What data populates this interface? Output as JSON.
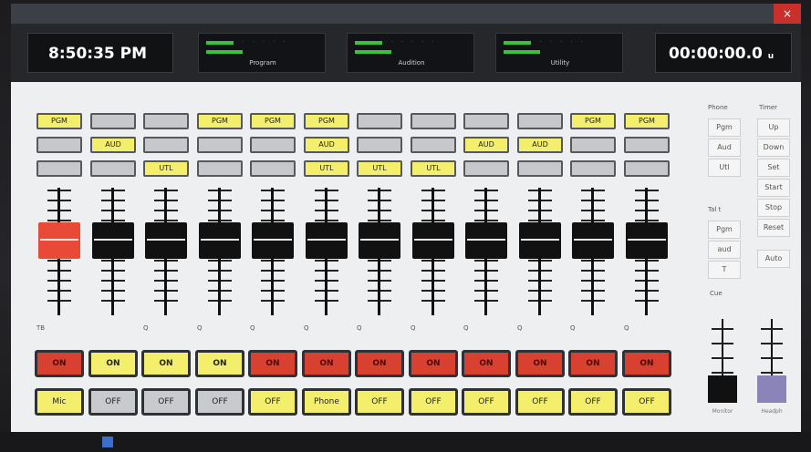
{
  "window": {
    "title": ""
  },
  "clock": {
    "time": "8:50:35 PM",
    "timer": "00:00:00.0",
    "timer_suffix": "u"
  },
  "meters": [
    {
      "label": "Program"
    },
    {
      "label": "Audition"
    },
    {
      "label": "Utility"
    }
  ],
  "channels": [
    {
      "pgm": "PGM",
      "aud": "",
      "utl": "",
      "name": "TB",
      "on": "ON",
      "on_color": "red",
      "off": "Mic",
      "off_color": "yellow",
      "knob": "red"
    },
    {
      "pgm": "",
      "aud": "AUD",
      "utl": "",
      "name": "",
      "on": "ON",
      "on_color": "yellow",
      "off": "OFF",
      "off_color": "gray",
      "knob": "black"
    },
    {
      "pgm": "",
      "aud": "",
      "utl": "UTL",
      "name": "Q",
      "on": "ON",
      "on_color": "yellow",
      "off": "OFF",
      "off_color": "gray",
      "knob": "black"
    },
    {
      "pgm": "PGM",
      "aud": "",
      "utl": "",
      "name": "Q",
      "on": "ON",
      "on_color": "yellow",
      "off": "OFF",
      "off_color": "gray",
      "knob": "black"
    },
    {
      "pgm": "PGM",
      "aud": "",
      "utl": "",
      "name": "Q",
      "on": "ON",
      "on_color": "red",
      "off": "OFF",
      "off_color": "yellow",
      "knob": "black"
    },
    {
      "pgm": "PGM",
      "aud": "AUD",
      "utl": "UTL",
      "name": "Q",
      "on": "ON",
      "on_color": "red",
      "off": "Phone",
      "off_color": "yellow",
      "knob": "black"
    },
    {
      "pgm": "",
      "aud": "",
      "utl": "UTL",
      "name": "Q",
      "on": "ON",
      "on_color": "red",
      "off": "OFF",
      "off_color": "yellow",
      "knob": "black"
    },
    {
      "pgm": "",
      "aud": "",
      "utl": "UTL",
      "name": "Q",
      "on": "ON",
      "on_color": "red",
      "off": "OFF",
      "off_color": "yellow",
      "knob": "black"
    },
    {
      "pgm": "",
      "aud": "AUD",
      "utl": "",
      "name": "Q",
      "on": "ON",
      "on_color": "red",
      "off": "OFF",
      "off_color": "yellow",
      "knob": "black"
    },
    {
      "pgm": "",
      "aud": "AUD",
      "utl": "",
      "name": "Q",
      "on": "ON",
      "on_color": "red",
      "off": "OFF",
      "off_color": "yellow",
      "knob": "black"
    },
    {
      "pgm": "PGM",
      "aud": "",
      "utl": "",
      "name": "Q",
      "on": "ON",
      "on_color": "red",
      "off": "OFF",
      "off_color": "yellow",
      "knob": "black"
    },
    {
      "pgm": "PGM",
      "aud": "",
      "utl": "",
      "name": "Q",
      "on": "ON",
      "on_color": "red",
      "off": "OFF",
      "off_color": "yellow",
      "knob": "black"
    }
  ],
  "right_panel": {
    "phone_header": "Phone",
    "phone_options": [
      "Pgm",
      "Aud",
      "Utl"
    ],
    "timer_header": "Timer",
    "timer_options": [
      "Up",
      "Down",
      "Set",
      "Start",
      "Stop",
      "Reset"
    ],
    "auto_label": "Auto",
    "tb_header": "Tal t",
    "tb_options": [
      "Pgm",
      "aud",
      "T"
    ],
    "cue_label": "Cue",
    "monitor_label": "Monitor",
    "headphone_label": "Headph"
  },
  "colors": {
    "active_yellow": "#f3ef6c",
    "on_red": "#d8412f",
    "meter_green": "#39c33a"
  }
}
